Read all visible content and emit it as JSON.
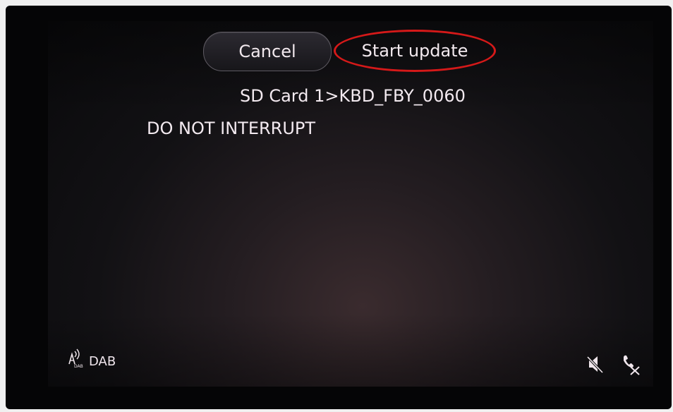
{
  "header": {
    "cancel_label": "Cancel",
    "start_update_label": "Start update"
  },
  "content": {
    "source_path": "SD Card 1>KBD_FBY_0060",
    "warning": "DO NOT INTERRUPT"
  },
  "status_bar": {
    "radio_source_label": "DAB",
    "radio_icon": "dab-radio-icon",
    "icons": [
      "mute-icon",
      "call-ended-icon"
    ]
  },
  "colors": {
    "highlight_circle": "#d51919",
    "text": "#f2e9ee"
  }
}
